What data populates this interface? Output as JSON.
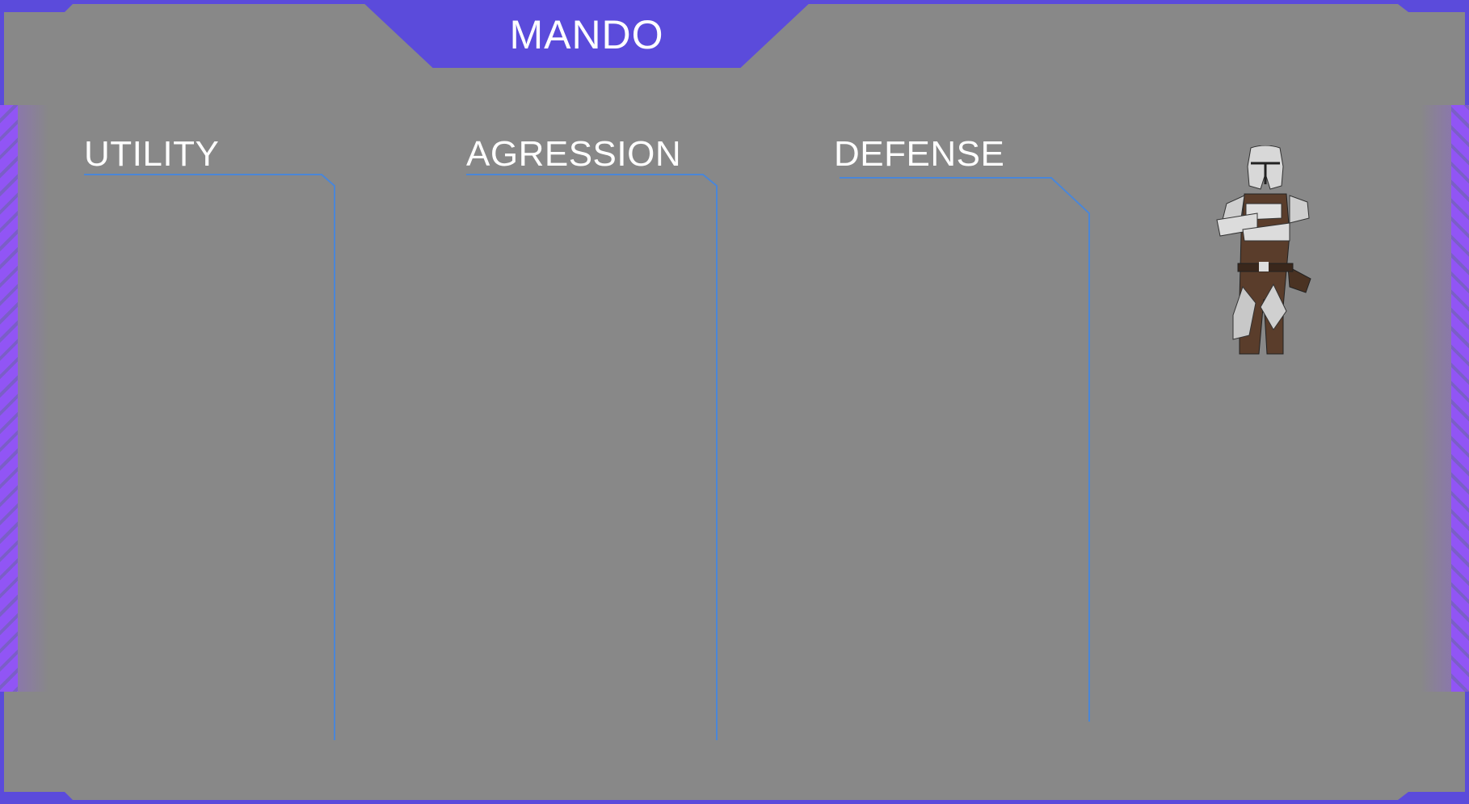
{
  "title": "MANDO",
  "columns": [
    {
      "label": "UTILITY"
    },
    {
      "label": "AGRESSION"
    },
    {
      "label": "DEFENSE"
    }
  ],
  "character": {
    "icon": "mandalorian-character-figure"
  },
  "colors": {
    "frame": "#5b4bdb",
    "stripes": "#9155f5",
    "background": "#888888",
    "column_lines": "#4a86d8",
    "text": "#ffffff"
  }
}
